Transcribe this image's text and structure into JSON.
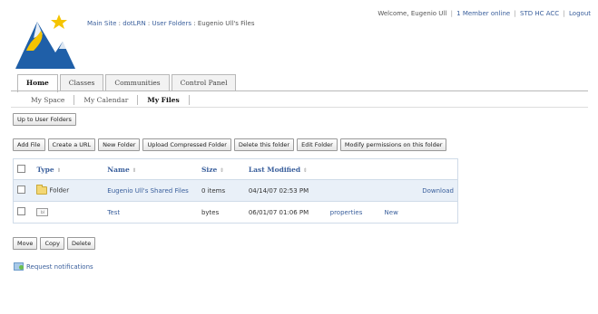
{
  "header": {
    "breadcrumb": [
      {
        "label": "Main Site"
      },
      {
        "label": "dotLRN"
      },
      {
        "label": "User Folders"
      },
      {
        "label": "Eugenio Ull's Files"
      }
    ],
    "breadcrumb_sep": ":",
    "welcome": "Welcome, Eugenio Ull",
    "members_online": "1 Member online",
    "std_hc_acc": "STD HC ACC",
    "logout": "Logout",
    "sep": "|"
  },
  "tabs": [
    {
      "label": "Home",
      "active": true
    },
    {
      "label": "Classes",
      "active": false
    },
    {
      "label": "Communities",
      "active": false
    },
    {
      "label": "Control Panel",
      "active": false
    }
  ],
  "subtabs": [
    {
      "label": "My Space",
      "active": false
    },
    {
      "label": "My Calendar",
      "active": false
    },
    {
      "label": "My Files",
      "active": true
    }
  ],
  "toolbar_top": {
    "up_to_user_folders": "Up to User Folders"
  },
  "toolbar": {
    "add_file": "Add File",
    "create_url": "Create a URL",
    "new_folder": "New Folder",
    "upload_compressed": "Upload Compressed Folder",
    "delete_folder": "Delete this folder",
    "edit_folder": "Edit Folder",
    "modify_permissions": "Modify permissions on this folder"
  },
  "table": {
    "headers": {
      "type": "Type",
      "name": "Name",
      "size": "Size",
      "last_modified": "Last Modified",
      "sort_glyph": "⇕"
    },
    "rows": [
      {
        "type": "Folder",
        "icon": "folder-icon",
        "name": "Eugenio Ull's Shared Files",
        "size": "0 items",
        "last_modified": "04/14/07 02:53 PM",
        "properties": "",
        "new": "",
        "download": "Download"
      },
      {
        "type": "",
        "icon": "file-icon",
        "icon_text": "bl",
        "name": "Test",
        "size": "bytes",
        "last_modified": "06/01/07 01:06 PM",
        "properties": "properties",
        "new": "New",
        "download": ""
      }
    ]
  },
  "bottom_actions": {
    "move": "Move",
    "copy": "Copy",
    "delete": "Delete"
  },
  "notifications": {
    "label": "Request notifications",
    "icon": "notification-icon"
  },
  "colors": {
    "link": "#3a5f9c",
    "row_highlight": "#e9f0f8",
    "logo_blue": "#1f5fa8",
    "logo_star": "#f5c400"
  }
}
